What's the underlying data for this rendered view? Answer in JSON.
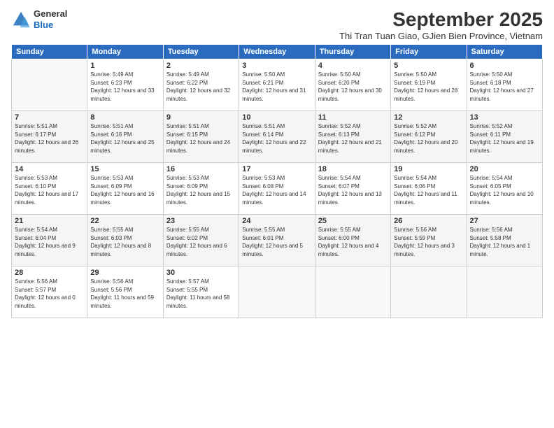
{
  "logo": {
    "general": "General",
    "blue": "Blue"
  },
  "title": "September 2025",
  "subtitle": "Thi Tran Tuan Giao, GJien Bien Province, Vietnam",
  "weekdays": [
    "Sunday",
    "Monday",
    "Tuesday",
    "Wednesday",
    "Thursday",
    "Friday",
    "Saturday"
  ],
  "weeks": [
    [
      {
        "day": "",
        "sunrise": "",
        "sunset": "",
        "daylight": ""
      },
      {
        "day": "1",
        "sunrise": "Sunrise: 5:49 AM",
        "sunset": "Sunset: 6:23 PM",
        "daylight": "Daylight: 12 hours and 33 minutes."
      },
      {
        "day": "2",
        "sunrise": "Sunrise: 5:49 AM",
        "sunset": "Sunset: 6:22 PM",
        "daylight": "Daylight: 12 hours and 32 minutes."
      },
      {
        "day": "3",
        "sunrise": "Sunrise: 5:50 AM",
        "sunset": "Sunset: 6:21 PM",
        "daylight": "Daylight: 12 hours and 31 minutes."
      },
      {
        "day": "4",
        "sunrise": "Sunrise: 5:50 AM",
        "sunset": "Sunset: 6:20 PM",
        "daylight": "Daylight: 12 hours and 30 minutes."
      },
      {
        "day": "5",
        "sunrise": "Sunrise: 5:50 AM",
        "sunset": "Sunset: 6:19 PM",
        "daylight": "Daylight: 12 hours and 28 minutes."
      },
      {
        "day": "6",
        "sunrise": "Sunrise: 5:50 AM",
        "sunset": "Sunset: 6:18 PM",
        "daylight": "Daylight: 12 hours and 27 minutes."
      }
    ],
    [
      {
        "day": "7",
        "sunrise": "Sunrise: 5:51 AM",
        "sunset": "Sunset: 6:17 PM",
        "daylight": "Daylight: 12 hours and 26 minutes."
      },
      {
        "day": "8",
        "sunrise": "Sunrise: 5:51 AM",
        "sunset": "Sunset: 6:16 PM",
        "daylight": "Daylight: 12 hours and 25 minutes."
      },
      {
        "day": "9",
        "sunrise": "Sunrise: 5:51 AM",
        "sunset": "Sunset: 6:15 PM",
        "daylight": "Daylight: 12 hours and 24 minutes."
      },
      {
        "day": "10",
        "sunrise": "Sunrise: 5:51 AM",
        "sunset": "Sunset: 6:14 PM",
        "daylight": "Daylight: 12 hours and 22 minutes."
      },
      {
        "day": "11",
        "sunrise": "Sunrise: 5:52 AM",
        "sunset": "Sunset: 6:13 PM",
        "daylight": "Daylight: 12 hours and 21 minutes."
      },
      {
        "day": "12",
        "sunrise": "Sunrise: 5:52 AM",
        "sunset": "Sunset: 6:12 PM",
        "daylight": "Daylight: 12 hours and 20 minutes."
      },
      {
        "day": "13",
        "sunrise": "Sunrise: 5:52 AM",
        "sunset": "Sunset: 6:11 PM",
        "daylight": "Daylight: 12 hours and 19 minutes."
      }
    ],
    [
      {
        "day": "14",
        "sunrise": "Sunrise: 5:53 AM",
        "sunset": "Sunset: 6:10 PM",
        "daylight": "Daylight: 12 hours and 17 minutes."
      },
      {
        "day": "15",
        "sunrise": "Sunrise: 5:53 AM",
        "sunset": "Sunset: 6:09 PM",
        "daylight": "Daylight: 12 hours and 16 minutes."
      },
      {
        "day": "16",
        "sunrise": "Sunrise: 5:53 AM",
        "sunset": "Sunset: 6:09 PM",
        "daylight": "Daylight: 12 hours and 15 minutes."
      },
      {
        "day": "17",
        "sunrise": "Sunrise: 5:53 AM",
        "sunset": "Sunset: 6:08 PM",
        "daylight": "Daylight: 12 hours and 14 minutes."
      },
      {
        "day": "18",
        "sunrise": "Sunrise: 5:54 AM",
        "sunset": "Sunset: 6:07 PM",
        "daylight": "Daylight: 12 hours and 13 minutes."
      },
      {
        "day": "19",
        "sunrise": "Sunrise: 5:54 AM",
        "sunset": "Sunset: 6:06 PM",
        "daylight": "Daylight: 12 hours and 11 minutes."
      },
      {
        "day": "20",
        "sunrise": "Sunrise: 5:54 AM",
        "sunset": "Sunset: 6:05 PM",
        "daylight": "Daylight: 12 hours and 10 minutes."
      }
    ],
    [
      {
        "day": "21",
        "sunrise": "Sunrise: 5:54 AM",
        "sunset": "Sunset: 6:04 PM",
        "daylight": "Daylight: 12 hours and 9 minutes."
      },
      {
        "day": "22",
        "sunrise": "Sunrise: 5:55 AM",
        "sunset": "Sunset: 6:03 PM",
        "daylight": "Daylight: 12 hours and 8 minutes."
      },
      {
        "day": "23",
        "sunrise": "Sunrise: 5:55 AM",
        "sunset": "Sunset: 6:02 PM",
        "daylight": "Daylight: 12 hours and 6 minutes."
      },
      {
        "day": "24",
        "sunrise": "Sunrise: 5:55 AM",
        "sunset": "Sunset: 6:01 PM",
        "daylight": "Daylight: 12 hours and 5 minutes."
      },
      {
        "day": "25",
        "sunrise": "Sunrise: 5:55 AM",
        "sunset": "Sunset: 6:00 PM",
        "daylight": "Daylight: 12 hours and 4 minutes."
      },
      {
        "day": "26",
        "sunrise": "Sunrise: 5:56 AM",
        "sunset": "Sunset: 5:59 PM",
        "daylight": "Daylight: 12 hours and 3 minutes."
      },
      {
        "day": "27",
        "sunrise": "Sunrise: 5:56 AM",
        "sunset": "Sunset: 5:58 PM",
        "daylight": "Daylight: 12 hours and 1 minute."
      }
    ],
    [
      {
        "day": "28",
        "sunrise": "Sunrise: 5:56 AM",
        "sunset": "Sunset: 5:57 PM",
        "daylight": "Daylight: 12 hours and 0 minutes."
      },
      {
        "day": "29",
        "sunrise": "Sunrise: 5:56 AM",
        "sunset": "Sunset: 5:56 PM",
        "daylight": "Daylight: 11 hours and 59 minutes."
      },
      {
        "day": "30",
        "sunrise": "Sunrise: 5:57 AM",
        "sunset": "Sunset: 5:55 PM",
        "daylight": "Daylight: 11 hours and 58 minutes."
      },
      {
        "day": "",
        "sunrise": "",
        "sunset": "",
        "daylight": ""
      },
      {
        "day": "",
        "sunrise": "",
        "sunset": "",
        "daylight": ""
      },
      {
        "day": "",
        "sunrise": "",
        "sunset": "",
        "daylight": ""
      },
      {
        "day": "",
        "sunrise": "",
        "sunset": "",
        "daylight": ""
      }
    ]
  ]
}
